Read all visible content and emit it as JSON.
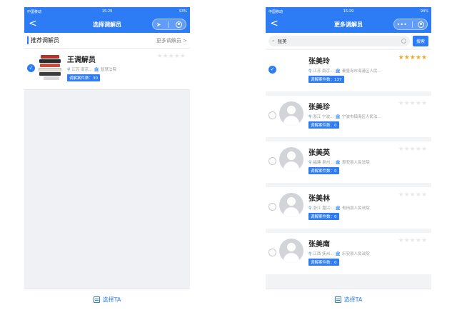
{
  "left": {
    "status": {
      "carrier": "中国移动",
      "time": "15:29",
      "battery": "93%"
    },
    "nav": {
      "back": "<",
      "title": "选择调解员"
    },
    "section": {
      "title": "推荐调解员",
      "more": "更多调解员 >"
    },
    "card": {
      "name": "王调解员",
      "location": "江苏 南京...",
      "court": "智慧法院",
      "count_label": "调解案件数：30",
      "rating": 0
    },
    "bottom": {
      "label": "选择TA"
    }
  },
  "right": {
    "status": {
      "carrier": "中国移动",
      "time": "15:29",
      "battery": "94%"
    },
    "nav": {
      "back": "<",
      "title": "更多调解员"
    },
    "search": {
      "value": "张美",
      "button": "搜索"
    },
    "mediators": [
      {
        "name": "张美玲",
        "location": "江苏 南京...",
        "court": "秦皇岛市海港区人民...",
        "count_label": "调解案件数：137",
        "rating": 4.5,
        "selected": true
      },
      {
        "name": "张美珍",
        "location": "浙江 宁波...",
        "court": "宁波市镇海区人民法...",
        "count_label": "调解案件数：0",
        "rating": 0,
        "selected": false
      },
      {
        "name": "张美英",
        "location": "福建 泉州...",
        "court": "惠安县人民法院",
        "count_label": "调解案件数：0",
        "rating": 0,
        "selected": false
      },
      {
        "name": "张美林",
        "location": "浙江 嘉兴...",
        "court": "青田县人民法院",
        "count_label": "调解案件数：0",
        "rating": 0,
        "selected": false
      },
      {
        "name": "张美南",
        "location": "江西 抚州...",
        "court": "乐安县人民法院",
        "count_label": "调解案件数：0",
        "rating": 0,
        "selected": false
      }
    ],
    "bottom": {
      "label": "选择TA"
    }
  },
  "colors": {
    "accent": "#2d7cf6",
    "star": "#f5a623"
  },
  "icons": {
    "location": "location-pin-icon",
    "court": "court-icon",
    "search": "search-icon",
    "more": "more-dots-icon",
    "target": "target-icon",
    "doc": "doc-icon"
  }
}
